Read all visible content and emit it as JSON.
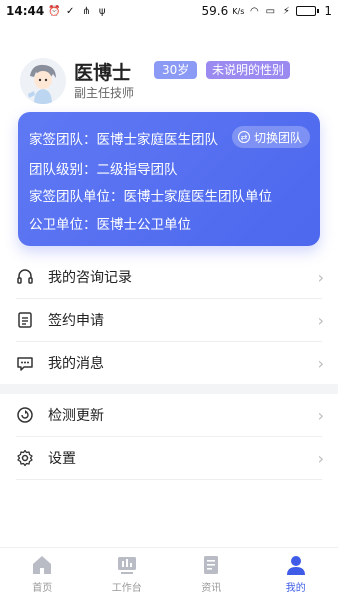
{
  "status": {
    "time": "14:44",
    "speed": "59.6",
    "speed_unit": "K/s",
    "battery": "1"
  },
  "profile": {
    "name": "医博士",
    "age": "30岁",
    "gender": "未说明的性别",
    "title": "副主任技师"
  },
  "team": {
    "team_line": "家签团队：医博士家庭医生团队",
    "switch_label": "切换团队",
    "level_line": "团队级别：二级指导团队",
    "unit_line": "家签团队单位：医博士家庭医生团队单位",
    "public_unit_line": "公卫单位：医博士公卫单位"
  },
  "menu": {
    "consult": "我的咨询记录",
    "sign": "签约申请",
    "messages": "我的消息",
    "update": "检测更新",
    "settings": "设置"
  },
  "tabs": {
    "home": "首页",
    "workbench": "工作台",
    "news": "资讯",
    "mine": "我的"
  },
  "colors": {
    "accent": "#3f5ce8",
    "card": "#5a73f2"
  }
}
